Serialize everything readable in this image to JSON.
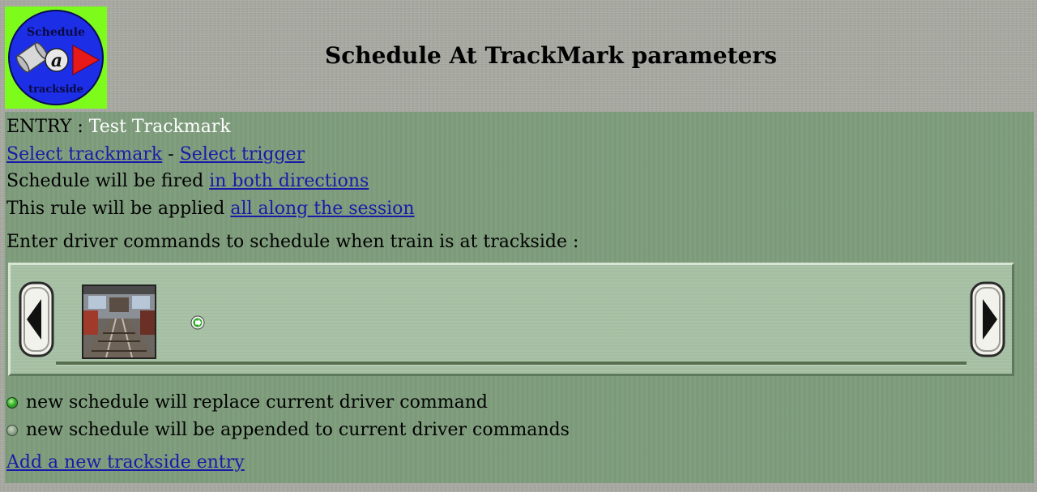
{
  "header": {
    "title": "Schedule At TrackMark parameters",
    "logo": {
      "top_text": "Schedule",
      "middle_text": "a",
      "bottom_text": "trackside",
      "background": "#7dfc1c",
      "circle": "#1c2ee6"
    }
  },
  "entry": {
    "prefix": "ENTRY : ",
    "name": "Test Trackmark"
  },
  "selectors": {
    "select_trackmark": "Select trackmark",
    "separator": " - ",
    "select_trigger": "Select trigger"
  },
  "direction": {
    "prefix": "Schedule will be fired ",
    "link": "in both directions"
  },
  "applied": {
    "prefix": "This rule will be applied ",
    "link": "all along the session"
  },
  "commands": {
    "instruction": "Enter driver commands to schedule when train is at trackside :",
    "scroll_left_icon": "arrow-left-icon",
    "scroll_right_icon": "arrow-right-icon",
    "thumbnail_icon": "station-platform-thumbnail",
    "go_icon": "green-arrow-icon"
  },
  "mode_options": [
    {
      "label": "new schedule will replace current driver command",
      "selected": true
    },
    {
      "label": "new schedule will be appended to current driver commands",
      "selected": false
    }
  ],
  "footer": {
    "add_link": "Add a new trackside entry"
  },
  "colors": {
    "page_bg": "#a6a8a0",
    "panel_bg": "#7f9e7d",
    "command_bg": "#a8c2a6",
    "link": "#1a1aa8"
  }
}
